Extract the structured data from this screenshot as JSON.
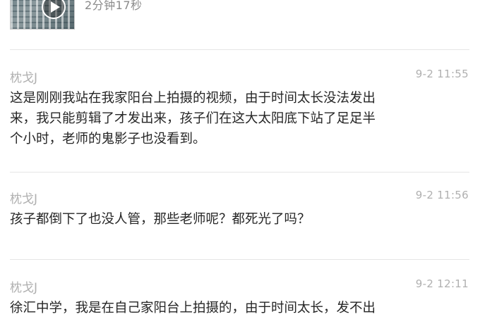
{
  "video": {
    "duration": "2分钟17秒",
    "thumbnail_icon": "play-icon"
  },
  "comments": [
    {
      "author": "枕戈J",
      "time": "9-2 11:55",
      "text": "这是刚刚我站在我家阳台上拍摄的视频，由于时间太长没法发出\n来，我只能剪辑了才发出来，孩子们在这大太阳底下站了足足半\n个小时，老师的鬼影子也没看到。"
    },
    {
      "author": "枕戈J",
      "time": "9-2 11:56",
      "text": "孩子都倒下了也没人管，那些老师呢？都死光了吗？"
    },
    {
      "author": "枕戈J",
      "time": "9-2 12:11",
      "text": "徐汇中学，我是在自己家阳台上拍摄的，由于时间太长，发不出"
    }
  ]
}
